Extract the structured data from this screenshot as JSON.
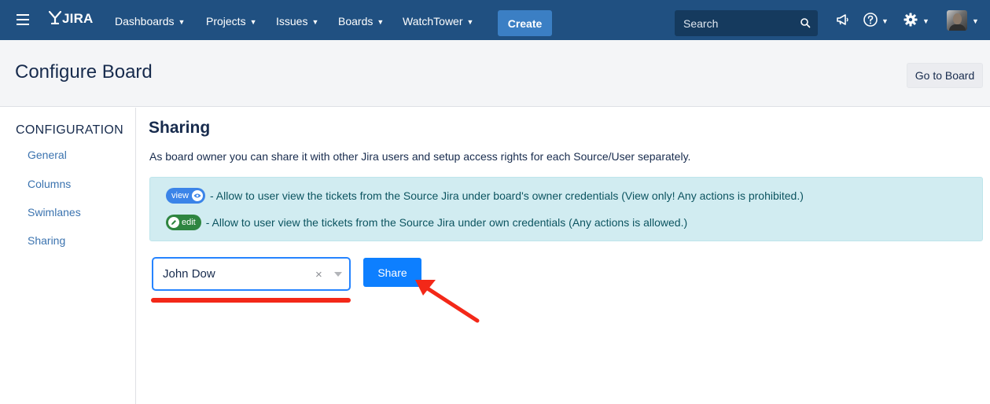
{
  "nav": {
    "logo_text": "JIRA",
    "items": [
      {
        "label": "Dashboards"
      },
      {
        "label": "Projects"
      },
      {
        "label": "Issues"
      },
      {
        "label": "Boards"
      },
      {
        "label": "WatchTower"
      }
    ],
    "create_label": "Create",
    "search_placeholder": "Search",
    "icons": [
      "menu-icon",
      "jira-logo-icon",
      "search-icon",
      "megaphone-icon",
      "help-icon",
      "gear-icon",
      "avatar"
    ],
    "bar_color": "#205081",
    "create_color": "#3b7fc4"
  },
  "header": {
    "title": "Configure Board",
    "go_to_board_label": "Go to Board"
  },
  "sidebar": {
    "heading": "CONFIGURATION",
    "items": [
      {
        "label": "General"
      },
      {
        "label": "Columns"
      },
      {
        "label": "Swimlanes"
      },
      {
        "label": "Sharing"
      }
    ]
  },
  "main": {
    "section_title": "Sharing",
    "description": "As board owner you can share it with other Jira users and setup access rights for each Source/User separately.",
    "info": {
      "view_badge": "view",
      "view_text": "- Allow to user view the tickets from the Source Jira under board's owner credentials (View only! Any actions is prohibited.)",
      "edit_badge": "edit",
      "edit_text": "- Allow to user view the tickets from the Source Jira under own credentials (Any actions is allowed.)",
      "background_color": "#d1ecf1"
    },
    "user_select": {
      "value": "John Dow",
      "clear_symbol": "×"
    },
    "share_label": "Share",
    "share_color": "#0d7fff",
    "annotation_color": "#f32818"
  }
}
